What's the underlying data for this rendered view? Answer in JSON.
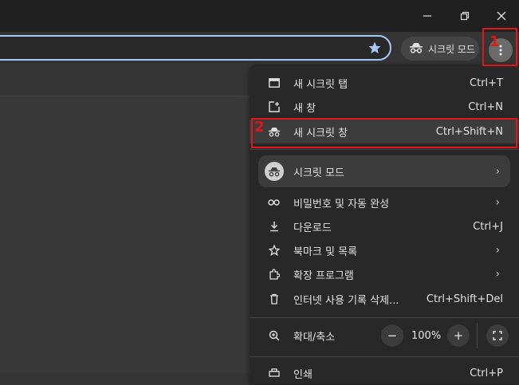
{
  "window": {
    "minimize_icon": "minimize-icon",
    "restore_icon": "restore-icon",
    "close_icon": "close-icon"
  },
  "toolbar": {
    "incognito_label": "시크릿 모드",
    "bookmark_star_icon": "star-icon",
    "menu_icon": "more-vert-icon"
  },
  "annotations": {
    "step1": "1",
    "step2": "2",
    "color": "#e0161b"
  },
  "menu": {
    "items": [
      {
        "label": "새 시크릿 탭",
        "shortcut": "Ctrl+T",
        "icon": "new-tab-icon"
      },
      {
        "label": "새 창",
        "shortcut": "Ctrl+N",
        "icon": "new-window-icon"
      },
      {
        "label": "새 시크릿 창",
        "shortcut": "Ctrl+Shift+N",
        "icon": "incognito-icon"
      }
    ],
    "profile": {
      "label": "시크릿 모드",
      "icon": "incognito-avatar-icon"
    },
    "items2": [
      {
        "label": "비밀번호 및 자동 완성",
        "icon": "key-icon"
      },
      {
        "label": "다운로드",
        "shortcut": "Ctrl+J",
        "icon": "download-icon"
      },
      {
        "label": "북마크 및 목록",
        "icon": "star-outline-icon"
      },
      {
        "label": "확장 프로그램",
        "icon": "extension-icon"
      },
      {
        "label": "인터넷 사용 기록 삭제...",
        "shortcut": "Ctrl+Shift+Del",
        "icon": "trash-icon"
      }
    ],
    "zoom": {
      "label": "확대/축소",
      "value": "100%",
      "minus": "−",
      "plus": "+",
      "icon": "zoom-icon",
      "fullscreen_icon": "fullscreen-icon"
    },
    "partial_item": {
      "label": "인쇄",
      "shortcut": "Ctrl+P"
    }
  }
}
